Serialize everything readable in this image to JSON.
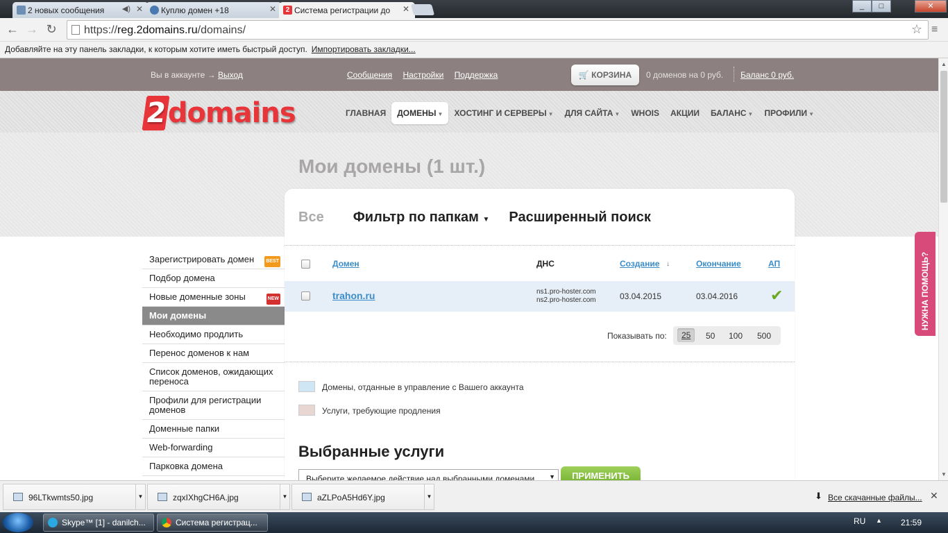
{
  "browser": {
    "tabs": [
      {
        "title": "2 новых сообщения",
        "icon": "message-icon"
      },
      {
        "title": "Куплю домен +18",
        "icon": "globe-icon"
      },
      {
        "title": "Система регистрации до",
        "icon": "2domains-icon"
      }
    ],
    "url_prefix": "https://",
    "url_host": "reg.2domains.ru",
    "url_path": "/domains/",
    "bookmarks_hint": "Добавляйте на эту панель закладки, к которым хотите иметь быстрый доступ.",
    "bookmarks_import": "Импортировать закладки..."
  },
  "topbar": {
    "account_text": "Вы в аккаунте →",
    "logout": "Выход",
    "links": [
      "Сообщения",
      "Настройки",
      "Поддержка"
    ],
    "cart": "КОРЗИНА",
    "cart_info": "0 доменов на 0 руб.",
    "balance": "Баланс 0 руб."
  },
  "logo": {
    "two": "2",
    "rest": "domains"
  },
  "nav": {
    "items": [
      {
        "label": "ГЛАВНАЯ",
        "dropdown": false
      },
      {
        "label": "ДОМЕНЫ",
        "dropdown": true
      },
      {
        "label": "ХОСТИНГ И СЕРВЕРЫ",
        "dropdown": true
      },
      {
        "label": "ДЛЯ САЙТА",
        "dropdown": true
      },
      {
        "label": "WHOIS",
        "dropdown": false
      },
      {
        "label": "АКЦИИ",
        "dropdown": false
      },
      {
        "label": "БАЛАНС",
        "dropdown": true
      },
      {
        "label": "ПРОФИЛИ",
        "dropdown": true
      }
    ]
  },
  "page": {
    "title": "Мои домены (1 шт.)",
    "filters": {
      "all": "Все",
      "folders": "Фильтр по папкам",
      "advanced": "Расширенный поиск"
    }
  },
  "table": {
    "headers": {
      "domain": "Домен",
      "dns": "ДНС",
      "created": "Создание",
      "expires": "Окончание",
      "ap": "АП"
    },
    "rows": [
      {
        "domain": "trahon.ru",
        "ns1": "ns1.pro-hoster.com",
        "ns2": "ns2.pro-hoster.com",
        "created": "03.04.2015",
        "expires": "03.04.2016",
        "autorenew": true
      }
    ]
  },
  "pager": {
    "label": "Показывать по:",
    "options": [
      "25",
      "50",
      "100",
      "500"
    ],
    "selected": "25"
  },
  "legend": [
    {
      "text": "Домены, отданные в управление с Вашего аккаунта",
      "color": "#cfe6f5"
    },
    {
      "text": "Услуги, требующие продления",
      "color": "#e8d6d2"
    }
  ],
  "selected_services": {
    "title": "Выбранные услуги",
    "select_value": "Выберите желаемое действие над выбранными доменами",
    "apply": "ПРИМЕНИТЬ"
  },
  "sidebar": {
    "items": [
      {
        "label": "Зарегистрировать домен",
        "badge": "BEST"
      },
      {
        "label": "Подбор домена"
      },
      {
        "label": "Новые доменные зоны",
        "badge": "NEW"
      },
      {
        "label": "Мои домены",
        "active": true
      },
      {
        "label": "Необходимо продлить"
      },
      {
        "label": "Перенос доменов к нам"
      },
      {
        "label": "Список доменов, ожидающих переноса"
      },
      {
        "label": "Профили для регистрации доменов"
      },
      {
        "label": "Доменные папки"
      },
      {
        "label": "Web-forwarding"
      },
      {
        "label": "Парковка домена"
      }
    ]
  },
  "help_tab": "НУЖНА ПОМОЩЬ?",
  "downloads": {
    "files": [
      "96LTkwmts50.jpg",
      "zqxIXhgCH6A.jpg",
      "aZLPoA5Hd6Y.jpg"
    ],
    "all_files": "Все скачанные файлы..."
  },
  "taskbar": {
    "items": [
      "Skype™ [1] - danilch...",
      "Система регистрац..."
    ],
    "lang": "RU",
    "time": "21:59"
  },
  "colors": {
    "accent": "#3a8dc8",
    "brand": "#e8353a",
    "apply": "#7cb833",
    "help": "#d74a7a"
  }
}
